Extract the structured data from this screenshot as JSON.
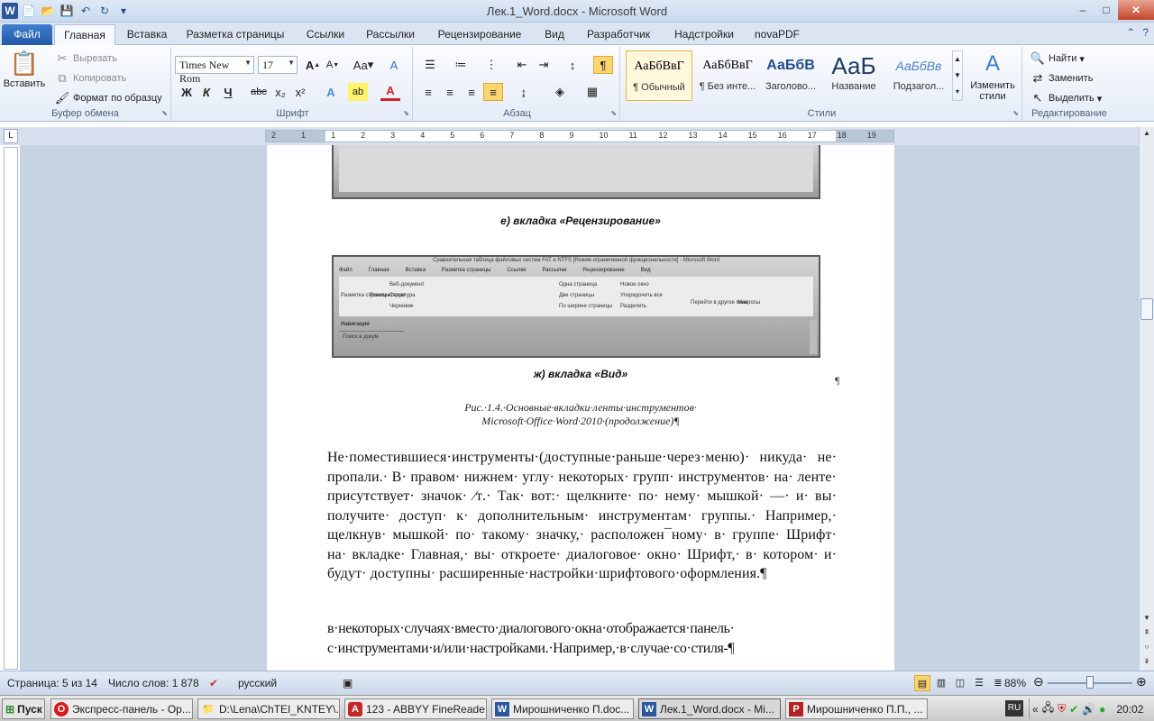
{
  "window": {
    "title": "Лек.1_Word.docx - Microsoft Word",
    "controls": {
      "minimize": "–",
      "maximize": "□",
      "close": "✕"
    }
  },
  "qat": {
    "word_logo": "W",
    "new": "📄",
    "open": "📂",
    "save": "💾",
    "undo": "↶",
    "redo": "↻",
    "customize": "▾"
  },
  "tabs": [
    {
      "label": "Файл"
    },
    {
      "label": "Главная"
    },
    {
      "label": "Вставка"
    },
    {
      "label": "Разметка страницы"
    },
    {
      "label": "Ссылки"
    },
    {
      "label": "Рассылки"
    },
    {
      "label": "Рецензирование"
    },
    {
      "label": "Вид"
    },
    {
      "label": "Разработчик"
    },
    {
      "label": "Надстройки"
    },
    {
      "label": "novaPDF"
    }
  ],
  "ribbon": {
    "clipboard": {
      "group": "Буфер обмена",
      "paste": "Вставить",
      "cut": "Вырезать",
      "copy": "Копировать",
      "format_painter": "Формат по образцу"
    },
    "font": {
      "group": "Шрифт",
      "font_name": "Times New Rom",
      "font_size": "17",
      "grow": "A",
      "shrink": "A",
      "case": "Aa",
      "clear": "A",
      "bold": "Ж",
      "italic": "К",
      "underline": "Ч",
      "strike": "abc",
      "sub": "x₂",
      "sup": "x²",
      "effects": "A",
      "highlight": "ab",
      "color": "A"
    },
    "paragraph": {
      "group": "Абзац",
      "show_marks": "¶"
    },
    "styles": {
      "group": "Стили",
      "items": [
        {
          "sample": "АаБбВвГ",
          "name": "¶ Обычный"
        },
        {
          "sample": "АаБбВвГ",
          "name": "¶ Без инте..."
        },
        {
          "sample": "АаБбВ",
          "name": "Заголово..."
        },
        {
          "sample": "АаБ",
          "name": "Название"
        },
        {
          "sample": "АаБбВв",
          "name": "Подзагол..."
        }
      ],
      "change": "Изменить стили"
    },
    "editing": {
      "group": "Редактирование",
      "find": "Найти",
      "replace": "Заменить",
      "select": "Выделить"
    }
  },
  "ruler": {
    "numbers": [
      "2",
      "1",
      "1",
      "2",
      "3",
      "4",
      "5",
      "6",
      "7",
      "8",
      "9",
      "10",
      "11",
      "12",
      "13",
      "14",
      "15",
      "16",
      "17",
      "18",
      "19"
    ],
    "corner": "L"
  },
  "document": {
    "caption_e": "е) вкладка «Рецензирование»",
    "caption_zh": "ж) вкладка «Вид»",
    "screenshot_title": "Сравнительная таблица файловых систем FAT и NTFS [Режим ограниченной функциональности] - Microsoft Word",
    "screenshot_tabs": [
      "Файл",
      "Главная",
      "Вставка",
      "Разметка страницы",
      "Ссылки",
      "Рассылки",
      "Рецензирование",
      "Вид"
    ],
    "screenshot_items": [
      "Разметка страницы",
      "Режим чтения",
      "Веб-документ",
      "Структура",
      "Черновик",
      "Одна страница",
      "Две страницы",
      "По ширине страницы",
      "Новое окно",
      "Упорядочить все",
      "Разделить",
      "Перейти в другое окно",
      "Макросы",
      "Навигация",
      "Поиск в докум"
    ],
    "figure_caption_line1": "Рис.·1.4.·Основные·вкладки·ленты·инструментов·",
    "figure_caption_line2": "Microsoft·Office·Word·2010·(продолжение)¶",
    "pilcrow": "¶",
    "paragraph1": "Не·поместившиеся·инструменты·(доступные·раньше·через·меню)· никуда· не· пропали.· В· правом· нижнем· углу· некоторых· групп· инструментов· на· ленте· присутствует· значок· ⁄ᴛ.· Так· вот:· щелкните· по· нему· мышкой· —· и· вы· получите· доступ· к· дополнительным· инструментам· группы.· Например,· щелкнув· мышкой· по· такому· значку,· расположен¯ному· в· группе· Шрифт· на· вкладке· Главная,· вы· откроете· диалоговое· окно· Шрифт,· в· котором· и· будут· доступны· расширенные·настройки·шрифтового·оформления.¶",
    "paragraph2": "в·некоторых·случаях·вместо·диалогового·окна·отображается·панель· с·инструментами·и/или·настройками.·Например,·в·случае·со·стиля-¶"
  },
  "status": {
    "page": "Страница: 5 из 14",
    "words": "Число слов: 1 878",
    "language": "русский",
    "zoom": "88%",
    "zoom_level": 0.5
  },
  "taskbar": {
    "start": "Пуск",
    "items": [
      {
        "label": "Экспресс-панель - Op...",
        "icon": "O"
      },
      {
        "label": "D:\\Lena\\ChTEI_KNTEY\\...",
        "icon": "📁"
      },
      {
        "label": "123 - ABBYY FineReade...",
        "icon": "A"
      },
      {
        "label": "Мирошниченко П.doc...",
        "icon": "W"
      },
      {
        "label": "Лек.1_Word.docx - Mi...",
        "icon": "W"
      },
      {
        "label": "Мирошниченко П.П., ...",
        "icon": "P"
      }
    ],
    "lang": "RU",
    "clock": "20:02"
  }
}
